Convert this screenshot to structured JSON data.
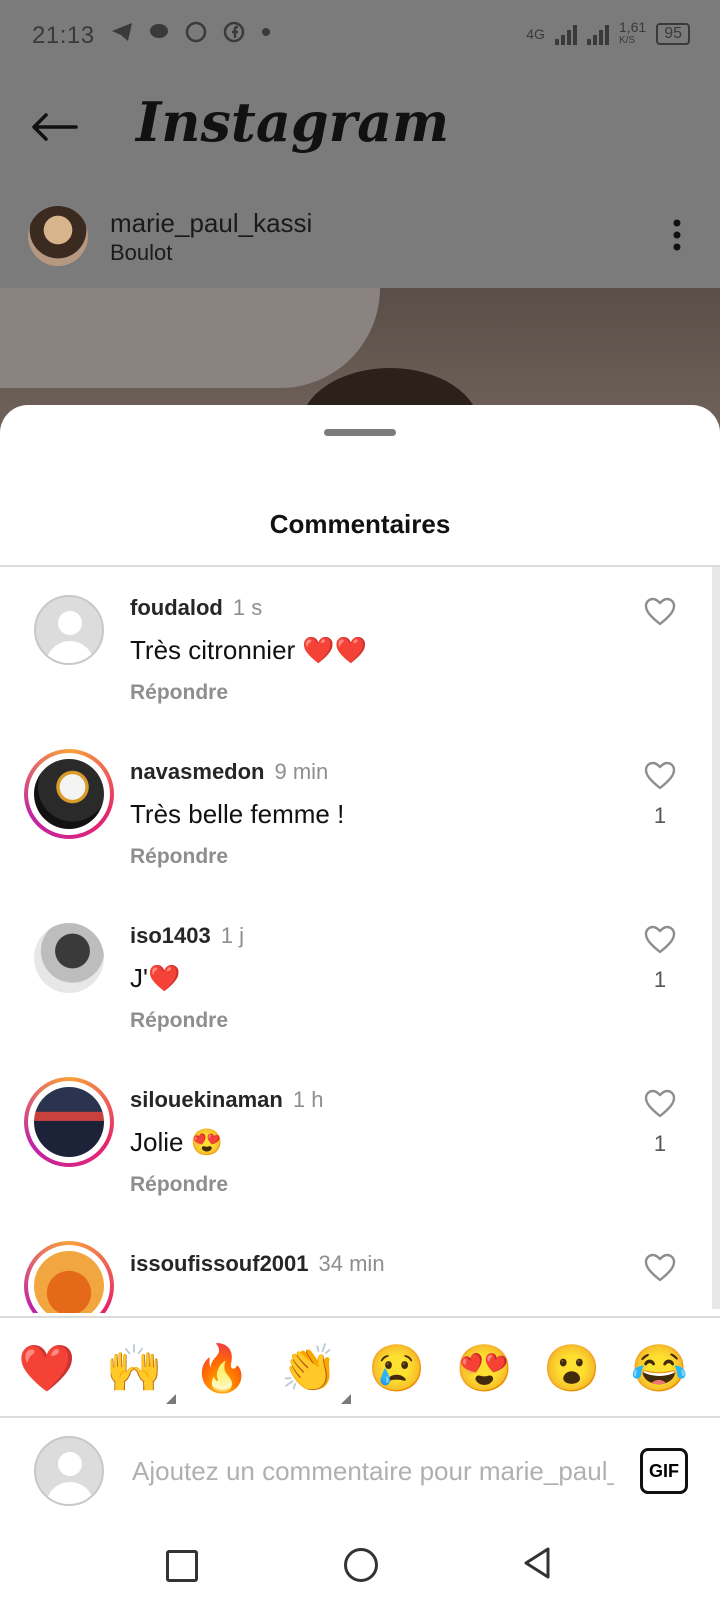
{
  "status_bar": {
    "time": "21:13",
    "network": "4G",
    "speed_value": "1,61",
    "speed_unit": "K/S",
    "battery": "95"
  },
  "app_bar": {
    "title": "Instagram"
  },
  "post": {
    "username": "marie_paul_kassi",
    "location": "Boulot"
  },
  "sheet": {
    "title": "Commentaires"
  },
  "comments": [
    {
      "username": "foudalod",
      "time": "1 s",
      "text": "Très citronnier ❤️❤️",
      "reply": "Répondre",
      "likes": "",
      "avatar": "default-avatar",
      "story_ring": false
    },
    {
      "username": "navasmedon",
      "time": "9 min",
      "text": "Très belle femme !",
      "reply": "Répondre",
      "likes": "1",
      "avatar": "eagle-avatar",
      "story_ring": true
    },
    {
      "username": "iso1403",
      "time": "1 j",
      "text": "J'❤️",
      "reply": "Répondre",
      "likes": "1",
      "avatar": "portrait-avatar",
      "story_ring": false
    },
    {
      "username": "silouekinaman",
      "time": "1 h",
      "text": "Jolie 😍",
      "reply": "Répondre",
      "likes": "1",
      "avatar": "screen-avatar",
      "story_ring": true
    },
    {
      "username": "issoufissouf2001",
      "time": "34 min",
      "text": "",
      "reply": "",
      "likes": "",
      "avatar": "orange-avatar",
      "story_ring": true
    }
  ],
  "emoji_reactions": [
    "❤️",
    "🙌",
    "🔥",
    "👏",
    "😢",
    "😍",
    "😮",
    "😂"
  ],
  "comment_input": {
    "placeholder": "Ajoutez un commentaire pour marie_paul_kassi..."
  },
  "gif_label": "GIF",
  "colors": {
    "story_ring_start": "#f9a13b",
    "story_ring_mid": "#e5246b",
    "muted_text": "#8e8e8e",
    "heart_red": "#e0242b"
  }
}
